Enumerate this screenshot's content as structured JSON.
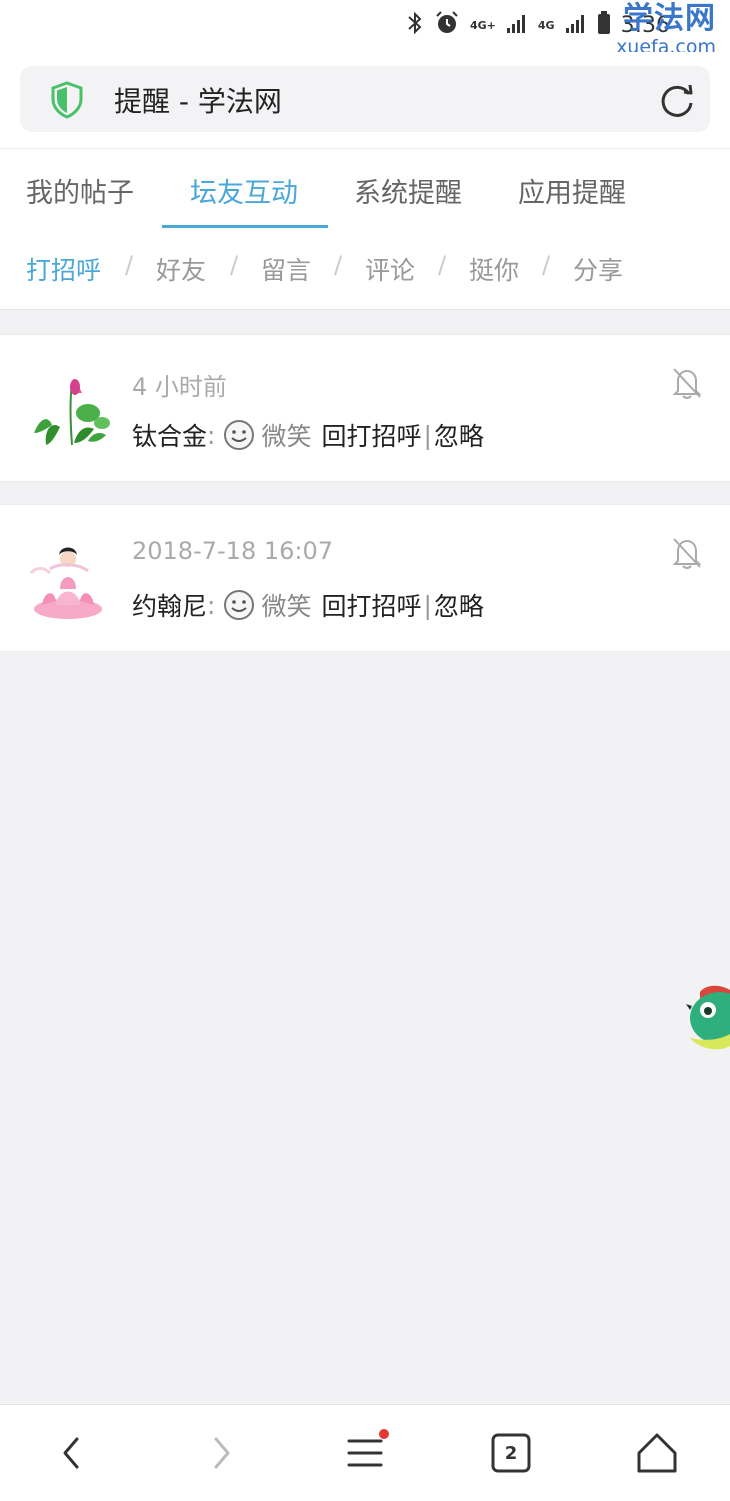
{
  "status_bar": {
    "network_1": "4G+",
    "network_2": "4G",
    "time": "3:36",
    "watermark_cn": "学法网",
    "watermark_en": "xuefa.com"
  },
  "address_bar": {
    "title": "提醒 - 学法网",
    "security_icon": "shield-icon",
    "reload_icon": "reload-icon"
  },
  "tabs": [
    {
      "label": "我的帖子",
      "active": false
    },
    {
      "label": "坛友互动",
      "active": true
    },
    {
      "label": "系统提醒",
      "active": false
    },
    {
      "label": "应用提醒",
      "active": false
    }
  ],
  "subtabs": [
    {
      "label": "打招呼",
      "active": true
    },
    {
      "label": "好友",
      "active": false
    },
    {
      "label": "留言",
      "active": false
    },
    {
      "label": "评论",
      "active": false
    },
    {
      "label": "挺你",
      "active": false
    },
    {
      "label": "分享",
      "active": false
    }
  ],
  "subtab_separator": "/",
  "notifications": [
    {
      "time": "4 小时前",
      "user": "钛合金",
      "colon": ":",
      "emotion": "微笑",
      "reply": "回打招呼",
      "pipe": "|",
      "ignore": "忽略"
    },
    {
      "time": "2018-7-18 16:07",
      "user": "约翰尼",
      "colon": ":",
      "emotion": "微笑",
      "reply": "回打招呼",
      "pipe": "|",
      "ignore": "忽略"
    }
  ],
  "bottom_nav": {
    "tab_count": "2",
    "menu_has_dot": true
  },
  "colors": {
    "accent": "#4aa8d8",
    "secure_green": "#49c06a",
    "badge_red": "#e53935",
    "watermark_blue": "#3a76c9"
  }
}
